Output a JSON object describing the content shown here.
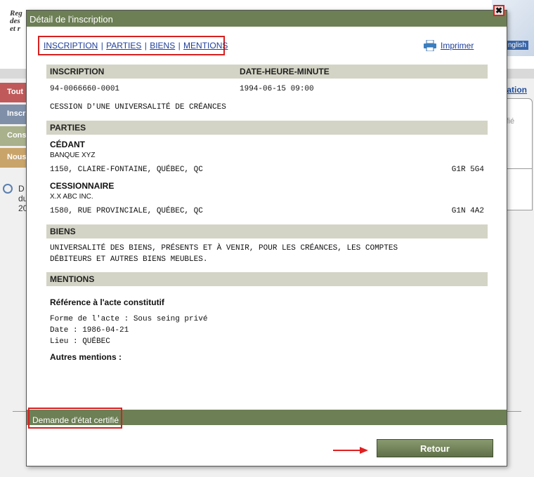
{
  "background": {
    "brand_lines": [
      "Reg",
      "des",
      "et r"
    ],
    "english_label": "nglish",
    "left_tabs": [
      {
        "label": "Tout",
        "color": "#c05a5a"
      },
      {
        "label": "Inscr",
        "color": "#7f8fa8"
      },
      {
        "label": "Cons",
        "color": "#a8b08c"
      },
      {
        "label": "Nous",
        "color": "#c9a46a"
      }
    ],
    "right_link": "ation",
    "right_box_text": "tifié",
    "clock_lines": [
      "D",
      "du",
      "20"
    ]
  },
  "modal": {
    "title": "Détail de l'inscription",
    "close_glyph": "✖",
    "nav": {
      "inscription": "INSCRIPTION",
      "parties": "PARTIES",
      "biens": "BIENS",
      "mentions": "MENTIONS",
      "separator": "|"
    },
    "print_label": "Imprimer",
    "inscription": {
      "header_left": "INSCRIPTION",
      "header_right": "DATE-HEURE-MINUTE",
      "number": "94-0066660-0001",
      "datetime": "1994-06-15 09:00",
      "nature": "CESSION D'UNE UNIVERSALITÉ DE CRÉANCES"
    },
    "parties": {
      "header": "PARTIES",
      "cedant": {
        "role": "CÉDANT",
        "name": "BANQUE XYZ",
        "address": "1150, CLAIRE-FONTAINE, QUÉBEC, QC",
        "postal": "G1R 5G4"
      },
      "cessionnaire": {
        "role": "CESSIONNAIRE",
        "name": "X.X ABC INC.",
        "address": "1580, RUE PROVINCIALE, QUÉBEC, QC",
        "postal": "G1N 4A2"
      }
    },
    "biens": {
      "header": "BIENS",
      "line1": "UNIVERSALITÉ DES BIENS, PRÉSENTS ET À VENIR, POUR LES CRÉANCES, LES COMPTES",
      "line2": "DÉBITEURS ET AUTRES BIENS MEUBLES."
    },
    "mentions": {
      "header": "MENTIONS",
      "reference_title": "Référence à l'acte constitutif",
      "forme": "Forme de l'acte : Sous seing privé",
      "date": "Date : 1986-04-21",
      "lieu": "Lieu : QUÉBEC",
      "autres": "Autres mentions :"
    },
    "footer": {
      "demande_label": "Demande d'état certifié",
      "retour_label": "Retour"
    }
  },
  "colors": {
    "title_bar": "#6d7f55",
    "section_header": "#d4d4c6",
    "highlight": "#d62020",
    "link": "#1f3f9a"
  }
}
